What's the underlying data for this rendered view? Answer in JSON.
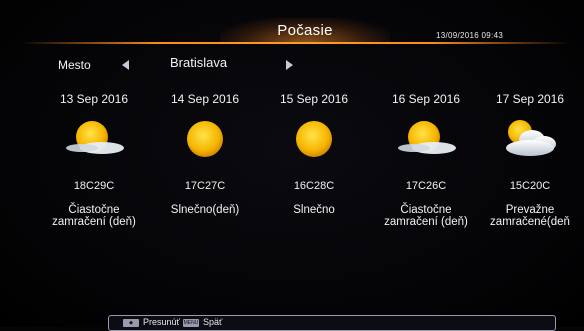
{
  "header": {
    "title": "Počasie",
    "datetime": "13/09/2016  09:43",
    "accent_color": "#ff8a1a"
  },
  "city": {
    "label": "Mesto",
    "value": "Bratislava"
  },
  "forecast": [
    {
      "date": "13 Sep 2016",
      "temp": "18C29C",
      "desc1": "Čiastočne",
      "desc2": "zamračení (deň)",
      "icon": "partly-cloudy-sun-icon"
    },
    {
      "date": "14 Sep 2016",
      "temp": "17C27C",
      "desc1": "Slnečno(deň)",
      "desc2": "",
      "icon": "sun-icon"
    },
    {
      "date": "15 Sep 2016",
      "temp": "16C28C",
      "desc1": "Slnečno",
      "desc2": "",
      "icon": "sun-icon"
    },
    {
      "date": "16 Sep 2016",
      "temp": "17C26C",
      "desc1": "Čiastočne",
      "desc2": "zamračení (deň)",
      "icon": "partly-cloudy-sun-icon"
    },
    {
      "date": "17 Sep 2016",
      "temp": "15C20C",
      "desc1": "Prevažne",
      "desc2": "zamračené(deň",
      "icon": "mostly-cloudy-icon"
    }
  ],
  "footer": {
    "key1_label": "◆",
    "move_label": "Presunúť",
    "key2_label": "MENU",
    "back_label": "Späť"
  }
}
